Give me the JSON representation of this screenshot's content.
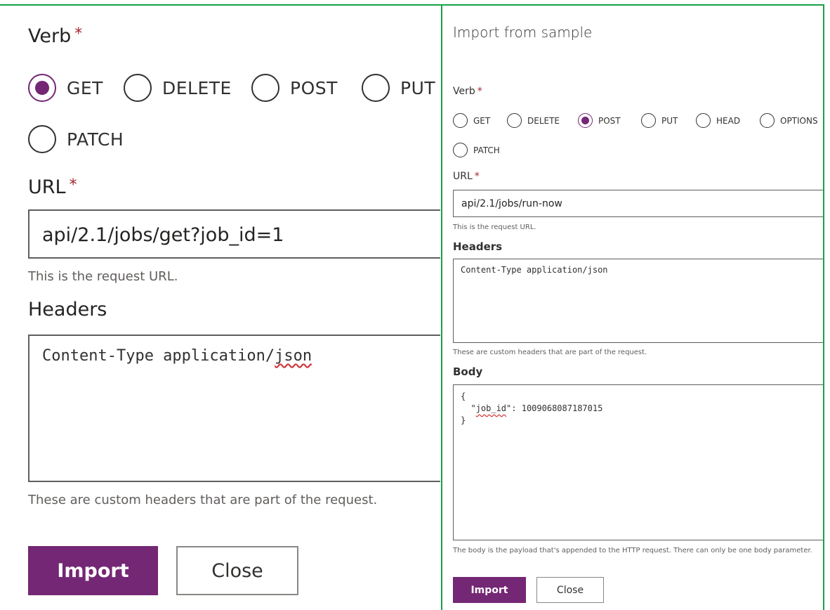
{
  "zoomed_panel": {
    "verb_label": "Verb",
    "required_marker": "*",
    "verbs": [
      "GET",
      "DELETE",
      "POST",
      "PUT",
      "PATCH"
    ],
    "selected_verb": "GET",
    "url_label": "URL",
    "url_value": "api/2.1/jobs/get?job_id=1",
    "url_hint": "This is the request URL.",
    "headers_label": "Headers",
    "headers_value_prefix": "Content-Type application/",
    "headers_value_suffix": "json",
    "headers_hint": "These are custom headers that are part of the request.",
    "import_label": "Import",
    "close_label": "Close"
  },
  "dialog": {
    "title": "Import from sample",
    "verb_label": "Verb",
    "required_marker": "*",
    "verbs": [
      "GET",
      "DELETE",
      "POST",
      "PUT",
      "HEAD",
      "OPTIONS",
      "PATCH"
    ],
    "selected_verb": "POST",
    "url_label": "URL",
    "url_value": "api/2.1/jobs/run-now",
    "url_hint": "This is the request URL.",
    "headers_label": "Headers",
    "headers_value": "Content-Type application/json",
    "headers_hint": "These are custom headers that are part of the request.",
    "body_label": "Body",
    "body_line1": "{",
    "body_key": "job_id",
    "body_value": ": 1009068087187015",
    "body_line3": "}",
    "body_hint": "The body is the payload that's appended to the HTTP request. There can only be one body parameter.",
    "import_label": "Import",
    "close_label": "Close"
  },
  "colors": {
    "accent": "#742774",
    "frame": "#1aa04a",
    "required": "#a4262c"
  }
}
